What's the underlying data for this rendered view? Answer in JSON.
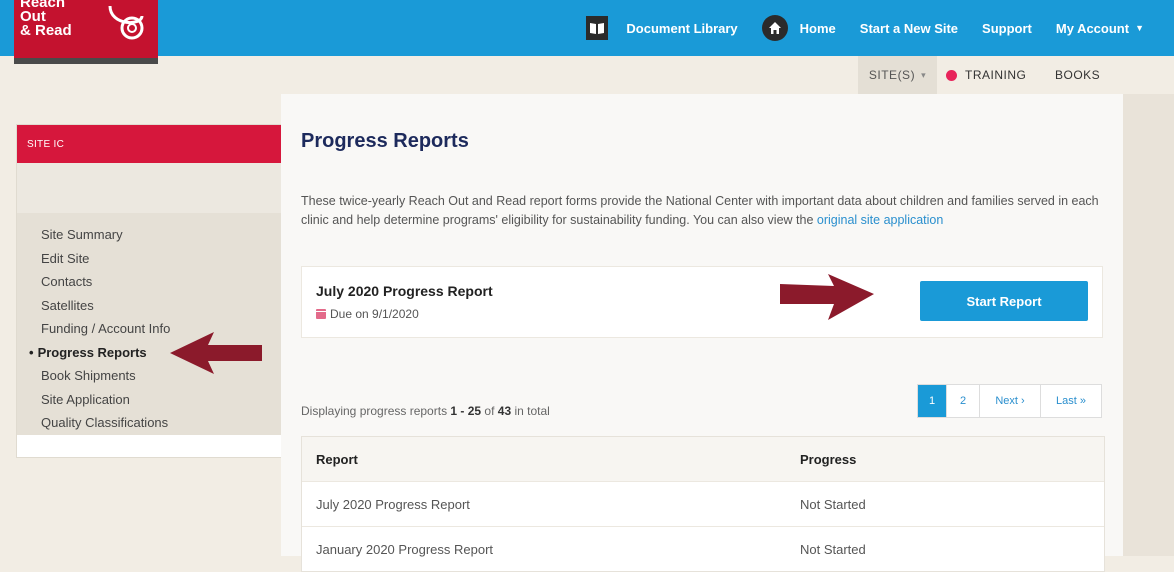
{
  "brand": {
    "logo_text": "Reach\nOut\n& Read"
  },
  "topnav": {
    "document_library": "Document Library",
    "home": "Home",
    "start_new_site": "Start a New Site",
    "support": "Support",
    "my_account": "My Account"
  },
  "subnav": {
    "sites": "SITE(S)",
    "training": "TRAINING",
    "books": "BOOKS"
  },
  "sidebar": {
    "header": "SITE IC",
    "items": [
      {
        "label": "Site Summary"
      },
      {
        "label": "Edit Site"
      },
      {
        "label": "Contacts"
      },
      {
        "label": "Satellites"
      },
      {
        "label": "Funding / Account Info"
      },
      {
        "label": "Progress Reports",
        "active": true
      },
      {
        "label": "Book Shipments"
      },
      {
        "label": "Site Application"
      },
      {
        "label": "Quality Classifications"
      }
    ]
  },
  "main": {
    "title": "Progress Reports",
    "intro_text": "These twice-yearly Reach Out and Read report forms provide the National Center with important data about children and families served in each clinic and help determine programs' eligibility for sustainability funding. You can also view the ",
    "intro_link": "original site application",
    "current_report": {
      "title": "July 2020 Progress Report",
      "due": "Due on 9/1/2020",
      "button": "Start Report"
    },
    "display_prefix": "Displaying progress reports ",
    "display_range": "1 - 25",
    "display_of": " of ",
    "display_total": "43",
    "display_suffix": " in total",
    "pagination": {
      "page1": "1",
      "page2": "2",
      "next": "Next ›",
      "last": "Last »"
    },
    "table": {
      "headers": [
        "Report",
        "Progress"
      ],
      "rows": [
        [
          "July 2020 Progress Report",
          "Not Started"
        ],
        [
          "January 2020 Progress Report",
          "Not Started"
        ]
      ]
    }
  },
  "colors": {
    "topbar": "#1a9ad7",
    "brand_red": "#c4122f",
    "arrow": "#8b1a2b",
    "title_navy": "#1d2a5c"
  }
}
